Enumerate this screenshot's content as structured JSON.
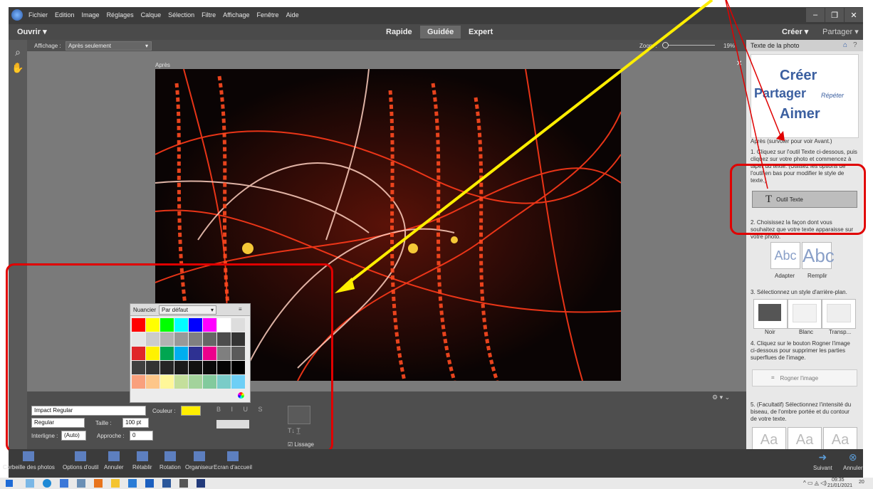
{
  "menubar": {
    "items": [
      "Fichier",
      "Edition",
      "Image",
      "Réglages",
      "Calque",
      "Sélection",
      "Filtre",
      "Affichage",
      "Fenêtre",
      "Aide"
    ]
  },
  "modebar": {
    "open": "Ouvrir",
    "modes": [
      "Rapide",
      "Guidée",
      "Expert"
    ],
    "create": "Créer",
    "share": "Partager"
  },
  "options": {
    "display_label": "Affichage :",
    "display_value": "Après seulement",
    "zoom_label": "Zoom :",
    "zoom_value": "19%"
  },
  "canvas": {
    "caption": "Après"
  },
  "panel": {
    "title": "Texte de la photo",
    "banner": [
      "Créer",
      "Partager",
      "Répéter",
      "Aimer"
    ],
    "after_note": "Après (survoler pour voir Avant.)",
    "step1": "1. Cliquez sur l'outil Texte ci-dessous, puis cliquez sur votre photo et commencez à taper du texte. (Utilisez les options de l'outil en bas pour modifier le style de texte.)",
    "tool_button": "Outil Texte",
    "step2": "2. Choisissez la façon dont vous souhaitez que votre texte apparaisse sur votre photo.",
    "fit_labels": [
      "Adapter",
      "Remplir"
    ],
    "step3": "3. Sélectionnez un style d'arrière-plan.",
    "bg_labels": [
      "Noir",
      "Blanc",
      "Transp..."
    ],
    "step4": "4. Cliquez sur le bouton Rogner l'image ci-dessous pour supprimer les parties superflues de l'image.",
    "crop_button": "Rogner l'image",
    "step5": "5. (Facultatif) Sélectionnez l'intensité du biseau, de l'ombre portée et du contour de votre texte."
  },
  "tooloptions": {
    "font": "Impact Regular",
    "style": "Regular",
    "size_label": "Taille :",
    "size": "100 pt",
    "leading_label": "Interligne :",
    "leading": "(Auto)",
    "tracking_label": "Approche :",
    "tracking": "0",
    "color_label": "Couleur :",
    "smoothing": "Lissage"
  },
  "swatches": {
    "label": "Nuancier",
    "preset": "Par défaut",
    "rows": [
      [
        "#ff0000",
        "#ffff00",
        "#00ff00",
        "#00ffff",
        "#0000ff",
        "#ff00ff",
        "#ffffff",
        "#dddddd"
      ],
      [
        "#e6e6e6",
        "#cccccc",
        "#b3b3b3",
        "#999999",
        "#808080",
        "#666666",
        "#4d4d4d",
        "#333333"
      ],
      [
        "#e0262a",
        "#fff200",
        "#00a651",
        "#00aeef",
        "#2e3192",
        "#ec008c",
        "#7f7f7f",
        "#5a5a5a"
      ],
      [
        "#404040",
        "#333333",
        "#262626",
        "#1a1a1a",
        "#111111",
        "#0a0a0a",
        "#050505",
        "#000000"
      ],
      [
        "#f9a07d",
        "#fdc689",
        "#fff799",
        "#c4df9b",
        "#a3d39c",
        "#82ca9d",
        "#7accc8",
        "#6dcff6"
      ]
    ]
  },
  "bottombar": {
    "items": [
      "Corbeille des photos",
      "Options d'outil",
      "Annuler",
      "Rétablir",
      "Rotation",
      "Organiseur",
      "Ecran d'accueil"
    ],
    "next": "Suivant",
    "cancel": "Annuler"
  },
  "taskbar": {
    "time": "09:35",
    "date": "21/01/2021",
    "badge": "20"
  }
}
